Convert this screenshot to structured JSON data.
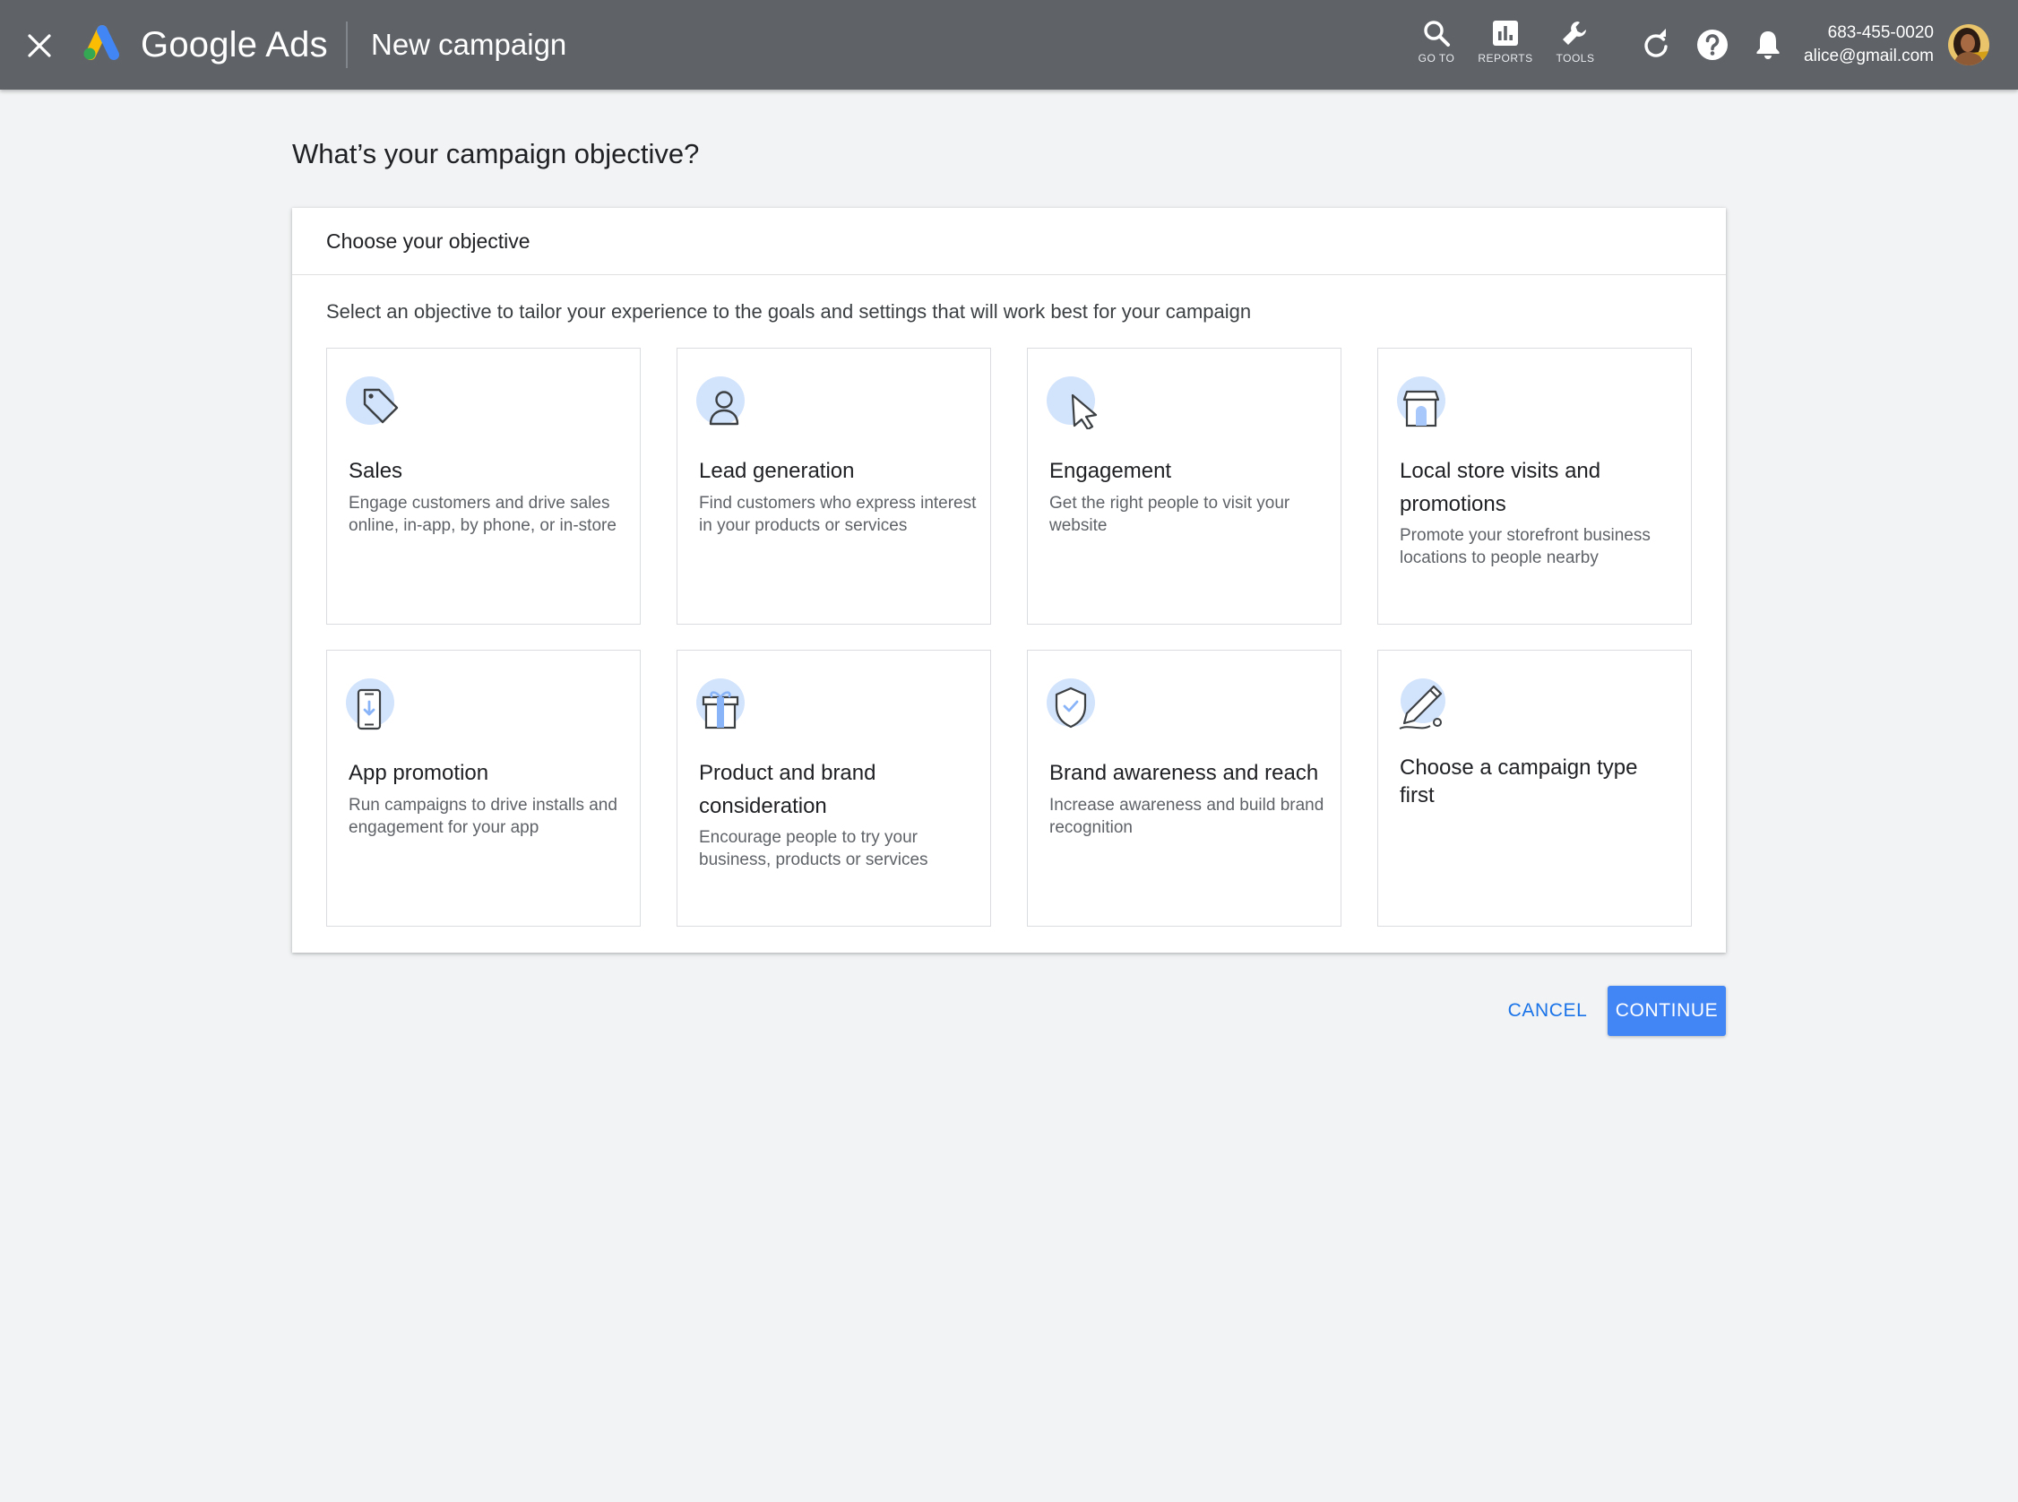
{
  "topbar": {
    "product_name": "Google Ads",
    "page_title": "New campaign",
    "tools": [
      {
        "label": "GO TO",
        "icon": "search-icon"
      },
      {
        "label": "REPORTS",
        "icon": "bar-chart-icon"
      },
      {
        "label": "TOOLS",
        "icon": "wrench-icon"
      }
    ],
    "account": {
      "phone": "683-455-0020",
      "email": "alice@gmail.com"
    }
  },
  "main": {
    "heading": "What’s your campaign objective?",
    "card": {
      "title": "Choose your objective",
      "description": "Select an objective to tailor your experience to the goals and settings that will work best for your campaign",
      "objectives": [
        {
          "title": "Sales",
          "description": "Engage customers and drive sales online, in-app, by phone, or in-store",
          "icon": "price-tag-icon"
        },
        {
          "title": "Lead generation",
          "description": "Find customers who express interest in your products or services",
          "icon": "person-icon"
        },
        {
          "title": "Engagement",
          "description": "Get the right people to visit your website",
          "icon": "cursor-icon"
        },
        {
          "title": "Local store visits and promotions",
          "description": "Promote your storefront business locations to people nearby",
          "icon": "storefront-icon"
        },
        {
          "title": "App promotion",
          "description": "Run campaigns to drive installs and engagement for your app",
          "icon": "phone-download-icon"
        },
        {
          "title": "Product and brand consideration",
          "description": "Encourage people to try your business, products or services",
          "icon": "gift-box-icon"
        },
        {
          "title": "Brand awareness and reach",
          "description": "Increase awareness and build brand recognition",
          "icon": "shield-check-icon"
        },
        {
          "title": "Choose a campaign type first",
          "description": "",
          "icon": "pencil-icon"
        }
      ]
    }
  },
  "actions": {
    "cancel_label": "CANCEL",
    "continue_label": "CONTINUE"
  },
  "colors": {
    "topbar": "#5f6368",
    "background": "#f1f3f4",
    "primary": "#4285f4",
    "link": "#1a73e8",
    "icon_circle": "#d2e3fc"
  }
}
